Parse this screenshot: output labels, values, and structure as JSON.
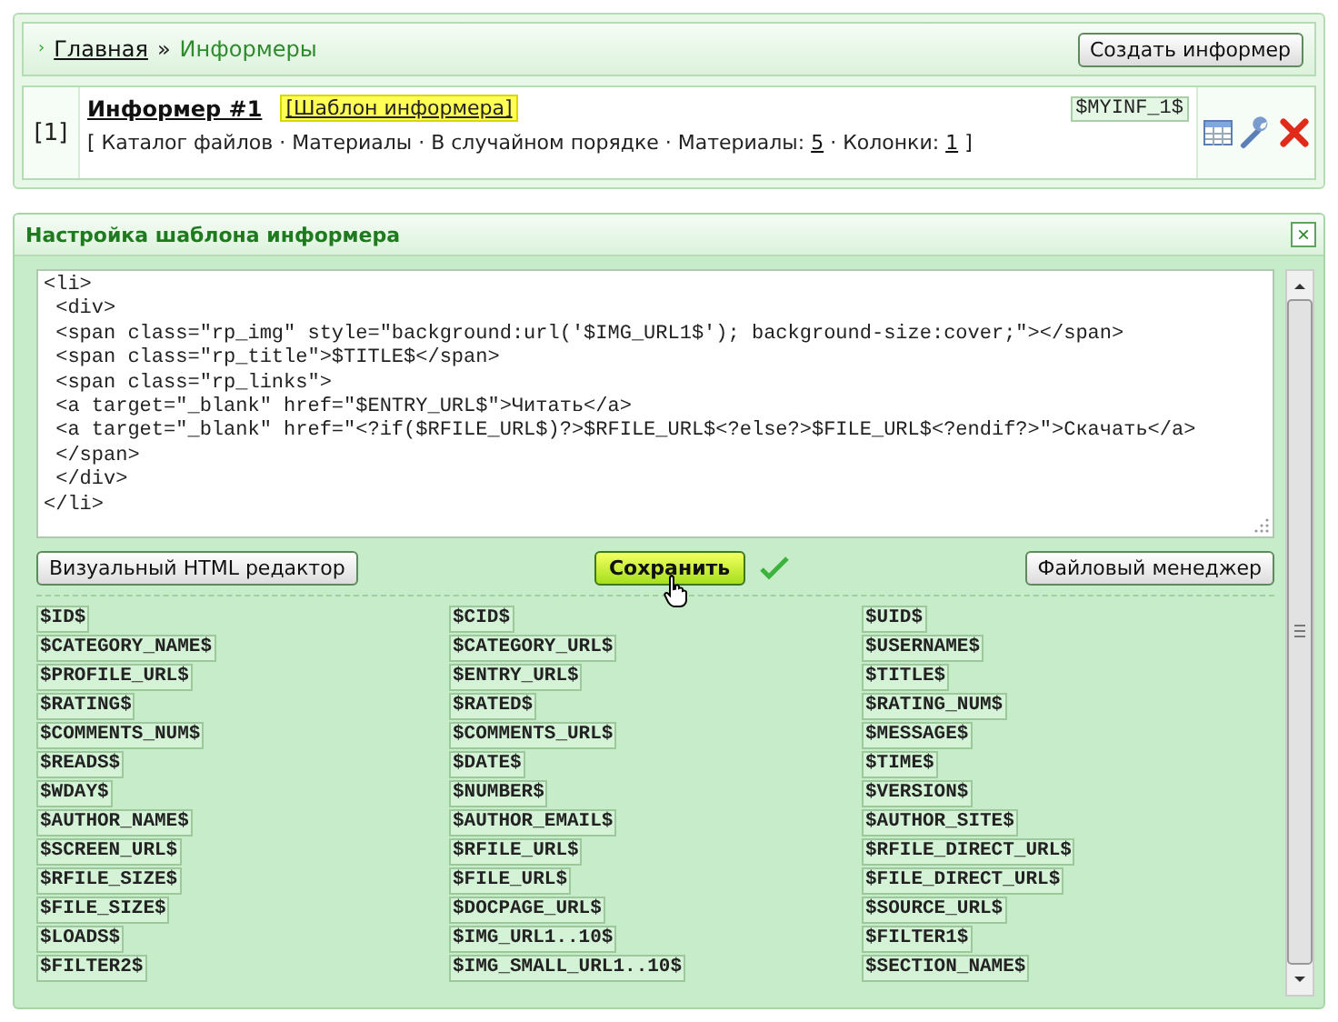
{
  "breadcrumb": {
    "separator_icon": "›",
    "home": "Главная",
    "divider": "»",
    "current": "Информеры"
  },
  "create_button": "Создать информер",
  "informer": {
    "number": "[1]",
    "title": "Информер #1",
    "template_link": "[Шаблон информера]",
    "code": "$MYINF_1$",
    "open": "[",
    "close": "]",
    "separator": "·",
    "items": [
      "Каталог файлов",
      "Материалы",
      "В случайном порядке"
    ],
    "materials_label": "Материалы:",
    "materials": "5",
    "columns_label": "Колонки:",
    "columns": "1"
  },
  "template_panel": {
    "title": "Настройка шаблона информера",
    "close": "×",
    "code_lines": [
      "<li>",
      " <div>",
      " <span class=\"rp_img\" style=\"background:url('$IMG_URL1$'); background-size:cover;\"></span>",
      " <span class=\"rp_title\">$TITLE$</span>",
      " <span class=\"rp_links\">",
      " <a target=\"_blank\" href=\"$ENTRY_URL$\">Читать</a>",
      " <a target=\"_blank\" href=\"<?if($RFILE_URL$)?>$RFILE_URL$<?else?>$FILE_URL$<?endif?>\">Скачать</a>",
      " </span>",
      " </div>",
      "</li>"
    ],
    "visual_editor_button": "Визуальный HTML редактор",
    "save_button": "Сохранить",
    "saved": true,
    "file_manager_button": "Файловый менеджер",
    "variables": [
      "$ID$",
      "$CID$",
      "$UID$",
      "$CATEGORY_NAME$",
      "$CATEGORY_URL$",
      "$USERNAME$",
      "$PROFILE_URL$",
      "$ENTRY_URL$",
      "$TITLE$",
      "$RATING$",
      "$RATED$",
      "$RATING_NUM$",
      "$COMMENTS_NUM$",
      "$COMMENTS_URL$",
      "$MESSAGE$",
      "$READS$",
      "$DATE$",
      "$TIME$",
      "$WDAY$",
      "$NUMBER$",
      "$VERSION$",
      "$AUTHOR_NAME$",
      "$AUTHOR_EMAIL$",
      "$AUTHOR_SITE$",
      "$SCREEN_URL$",
      "$RFILE_URL$",
      "$RFILE_DIRECT_URL$",
      "$RFILE_SIZE$",
      "$FILE_URL$",
      "$FILE_DIRECT_URL$",
      "$FILE_SIZE$",
      "$DOCPAGE_URL$",
      "$SOURCE_URL$",
      "$LOADS$",
      "$IMG_URL1..10$",
      "$FILTER1$",
      "$FILTER2$",
      "$IMG_SMALL_URL1..10$",
      "$SECTION_NAME$"
    ]
  }
}
